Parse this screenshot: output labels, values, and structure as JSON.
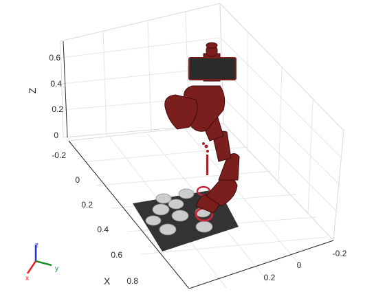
{
  "axes": {
    "x_label": "X",
    "z_label": "Z",
    "z_ticks": [
      "0",
      "0.2",
      "0.4",
      "0.6"
    ],
    "x_ticks": [
      "-0.2",
      "0",
      "0.2",
      "0.4",
      "0.6",
      "0.8"
    ],
    "y_ticks": [
      "-0.2",
      "0",
      "0.2"
    ]
  },
  "triad": {
    "x": "x",
    "y": "y",
    "z": "z"
  },
  "colors": {
    "robot": "#7a1e1e",
    "robot_dark": "#3d0a0a",
    "mat": "#333333",
    "axis_x": "#e8202a",
    "axis_y": "#1a8a2a",
    "axis_z": "#2030d8"
  }
}
